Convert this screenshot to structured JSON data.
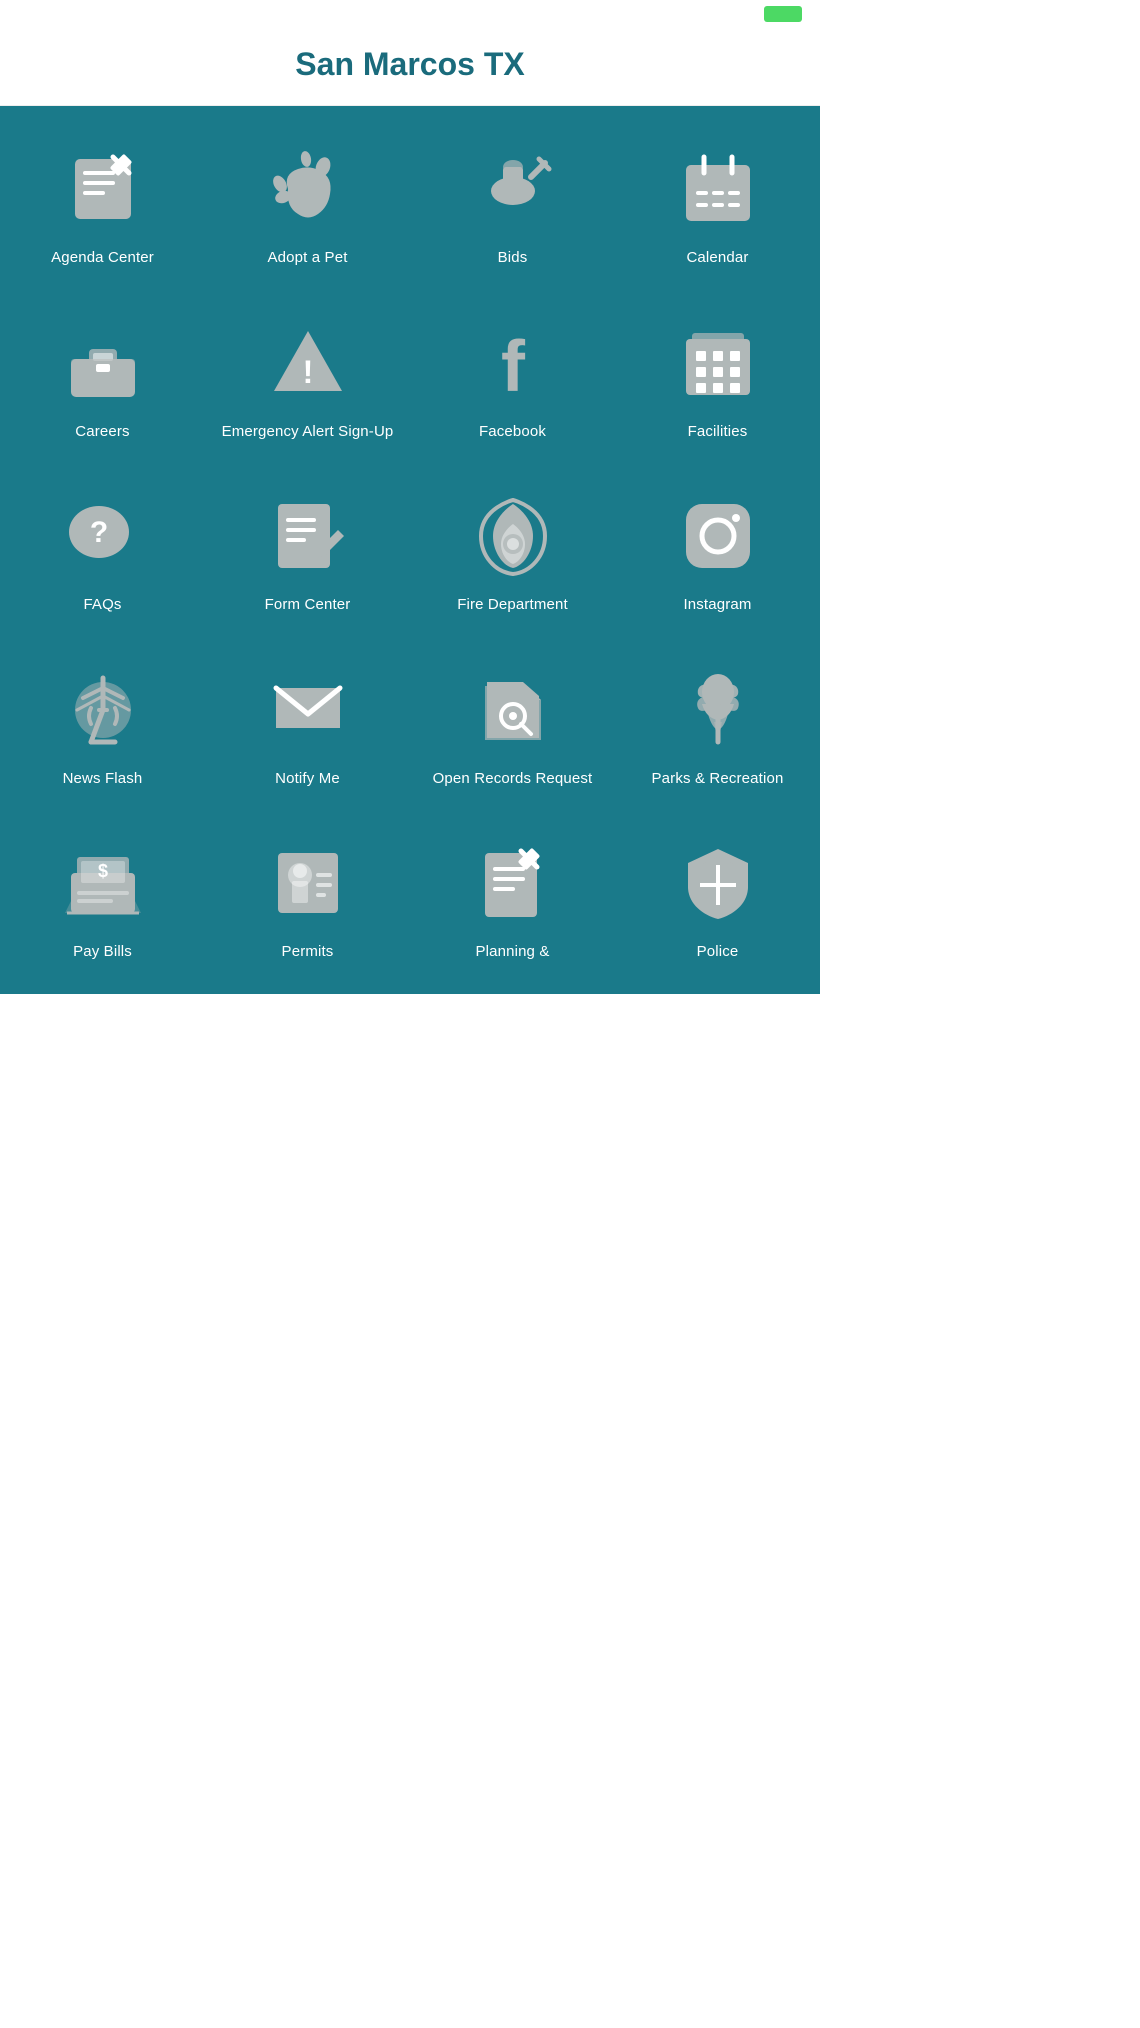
{
  "app": {
    "title": "San Marcos TX"
  },
  "statusBar": {
    "batteryColor": "#4cd964"
  },
  "grid": {
    "items": [
      {
        "id": "agenda-center",
        "label": "Agenda Center",
        "icon": "agenda"
      },
      {
        "id": "adopt-a-pet",
        "label": "Adopt a Pet",
        "icon": "pet"
      },
      {
        "id": "bids",
        "label": "Bids",
        "icon": "bids"
      },
      {
        "id": "calendar",
        "label": "Calendar",
        "icon": "calendar"
      },
      {
        "id": "careers",
        "label": "Careers",
        "icon": "careers"
      },
      {
        "id": "emergency-alert",
        "label": "Emergency Alert Sign-Up",
        "icon": "emergency"
      },
      {
        "id": "facebook",
        "label": "Facebook",
        "icon": "facebook"
      },
      {
        "id": "facilities",
        "label": "Facilities",
        "icon": "facilities"
      },
      {
        "id": "faqs",
        "label": "FAQs",
        "icon": "faqs"
      },
      {
        "id": "form-center",
        "label": "Form Center",
        "icon": "form-center"
      },
      {
        "id": "fire-department",
        "label": "Fire Department",
        "icon": "fire"
      },
      {
        "id": "instagram",
        "label": "Instagram",
        "icon": "instagram"
      },
      {
        "id": "news-flash",
        "label": "News Flash",
        "icon": "news-flash"
      },
      {
        "id": "notify-me",
        "label": "Notify Me",
        "icon": "notify"
      },
      {
        "id": "open-records",
        "label": "Open Records Request",
        "icon": "open-records"
      },
      {
        "id": "parks",
        "label": "Parks & Recreation",
        "icon": "parks"
      },
      {
        "id": "pay-bills",
        "label": "Pay Bills",
        "icon": "pay-bills"
      },
      {
        "id": "permits",
        "label": "Permits",
        "icon": "permits"
      },
      {
        "id": "planning",
        "label": "Planning &",
        "icon": "planning"
      },
      {
        "id": "police",
        "label": "Police",
        "icon": "police"
      }
    ]
  }
}
